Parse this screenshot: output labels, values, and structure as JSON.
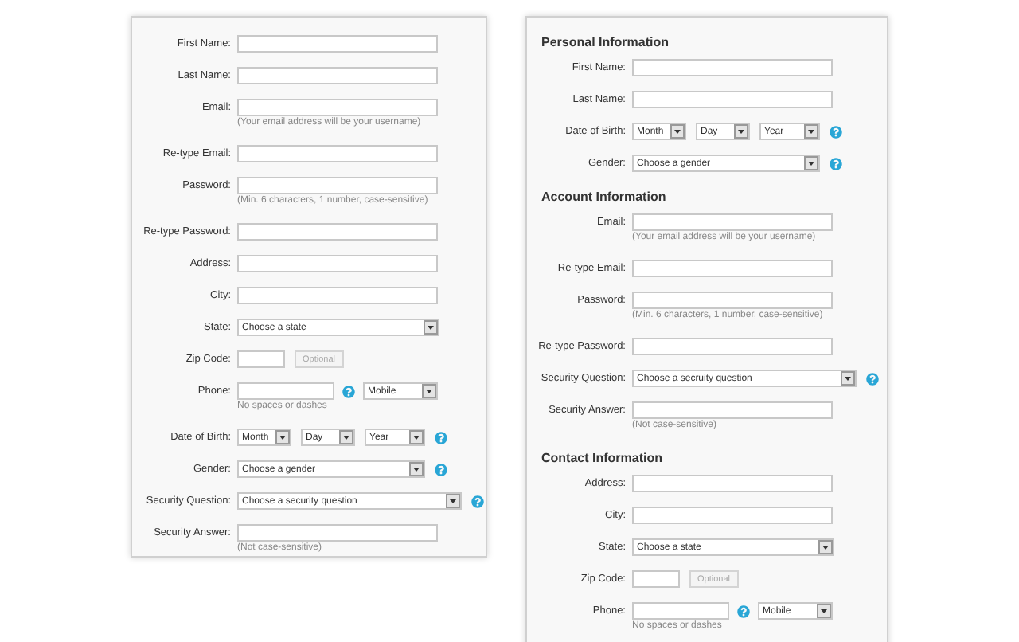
{
  "left_form": {
    "fields": [
      {
        "kind": "text",
        "label": "First Name:"
      },
      {
        "kind": "text",
        "label": "Last Name:"
      },
      {
        "kind": "text",
        "label": "Email:",
        "hint": "(Your email address will be your username)"
      },
      {
        "kind": "text",
        "label": "Re-type Email:"
      },
      {
        "kind": "text",
        "label": "Password:",
        "hint": "(Min. 6 characters, 1 number, case-sensitive)"
      },
      {
        "kind": "text",
        "label": "Re-type Password:"
      },
      {
        "kind": "text",
        "label": "Address:"
      },
      {
        "kind": "text",
        "label": "City:"
      },
      {
        "kind": "select",
        "label": "State:",
        "value": "Choose a state"
      },
      {
        "kind": "zip",
        "label": "Zip Code:",
        "button": "Optional"
      },
      {
        "kind": "phone",
        "label": "Phone:",
        "hint": "No spaces or dashes",
        "help": true,
        "value": "Mobile"
      },
      {
        "kind": "date",
        "label": "Date of Birth:",
        "selects": [
          "Month",
          "Day",
          "Year"
        ],
        "help": true
      },
      {
        "kind": "select",
        "label": "Gender:",
        "value": "Choose a gender",
        "help": true
      },
      {
        "kind": "wide_select",
        "label": "Security Question:",
        "value": "Choose a security question",
        "help": true
      },
      {
        "kind": "text",
        "label": "Security Answer:",
        "hint": "(Not case-sensitive)"
      }
    ]
  },
  "right_form": {
    "sections": [
      {
        "heading": "Personal Information",
        "fields": [
          {
            "kind": "text",
            "label": "First Name:"
          },
          {
            "kind": "text",
            "label": "Last Name:"
          },
          {
            "kind": "date",
            "label": "Date of Birth:",
            "selects": [
              "Month",
              "Day",
              "Year"
            ],
            "help": true
          },
          {
            "kind": "select",
            "label": "Gender:",
            "value": "Choose a gender",
            "help": true
          }
        ]
      },
      {
        "heading": "Account Information",
        "fields": [
          {
            "kind": "text",
            "label": "Email:",
            "hint": "(Your email address will be your username)"
          },
          {
            "kind": "text",
            "label": "Re-type Email:"
          },
          {
            "kind": "text",
            "label": "Password:",
            "hint": "(Min. 6 characters, 1 number, case-sensitive)"
          },
          {
            "kind": "text",
            "label": "Re-type Password:"
          },
          {
            "kind": "wide_select",
            "label": "Security Question:",
            "value": "Choose a secruity question",
            "help": true
          },
          {
            "kind": "text",
            "label": "Security Answer:",
            "hint": "(Not case-sensitive)"
          }
        ]
      },
      {
        "heading": "Contact Information",
        "fields": [
          {
            "kind": "text",
            "label": "Address:"
          },
          {
            "kind": "text",
            "label": "City:"
          },
          {
            "kind": "select",
            "label": "State:",
            "value": "Choose a state"
          },
          {
            "kind": "zip",
            "label": "Zip Code:",
            "button": "Optional"
          },
          {
            "kind": "phone",
            "label": "Phone:",
            "hint": "No spaces or dashes",
            "help": true,
            "value": "Mobile"
          }
        ]
      }
    ]
  }
}
